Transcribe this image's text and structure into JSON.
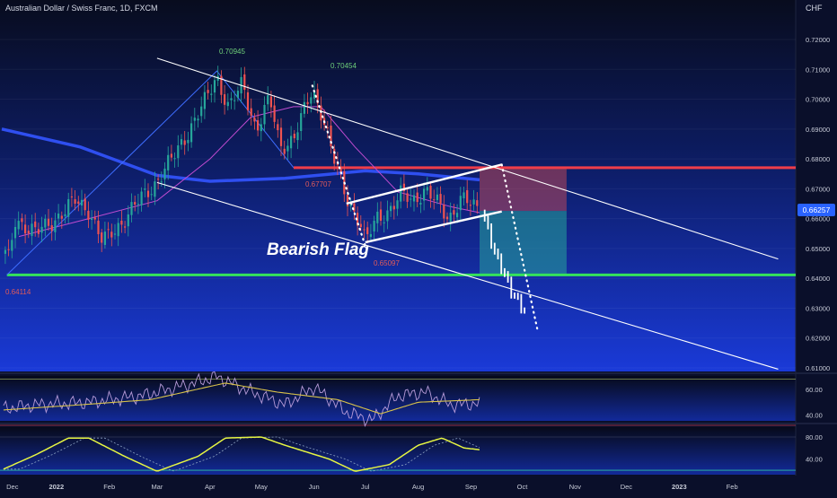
{
  "header": {
    "title": "Australian Dollar / Swiss Franc, 1D, FXCM",
    "currency": "CHF"
  },
  "colors": {
    "bull": "#26a69a",
    "bear": "#ef5350",
    "ma_long": "#2f4ff0",
    "ma_short": "#c04bd0",
    "support": "#35e35b",
    "resistance": "#ef3d4a",
    "price_badge": "#2962ff",
    "rsi": "#b79bd8",
    "rsi_signal": "#d8c24a",
    "osc": "#e6f542"
  },
  "main": {
    "price_label": "0.66257",
    "annotations": {
      "high1": "0.70945",
      "high2": "0.70454",
      "mid": "0.67707",
      "low_flag": "0.65097",
      "low_start": "0.64114",
      "pattern": "Bearish Flag"
    }
  },
  "chart_data": [
    {
      "type": "candlestick",
      "title": "Australian Dollar / Swiss Franc, 1D, FXCM",
      "ylim": [
        0.61,
        0.72
      ],
      "y_ticks": [
        "0.72000",
        "0.71000",
        "0.70000",
        "0.69000",
        "0.68000",
        "0.67000",
        "0.66000",
        "0.65000",
        "0.64000",
        "0.63000",
        "0.62000",
        "0.61000"
      ],
      "x_ticks": [
        "Dec",
        "2022",
        "Feb",
        "Mar",
        "Apr",
        "May",
        "Jun",
        "Jul",
        "Aug",
        "Sep",
        "Oct",
        "Nov",
        "Dec",
        "2023",
        "Feb"
      ],
      "key_points": [
        {
          "date": "2021-12-03",
          "price": 0.64114
        },
        {
          "date": "2022-04-05",
          "price": 0.70945
        },
        {
          "date": "2022-05-31",
          "price": 0.70454
        },
        {
          "date": "2022-05-20",
          "price": 0.67707
        },
        {
          "date": "2022-07-01",
          "price": 0.65097
        },
        {
          "date": "2022-09-06",
          "price": 0.66257
        }
      ],
      "close_path": [
        [
          "2021-12-01",
          0.654
        ],
        [
          "2021-12-03",
          0.643
        ],
        [
          "2021-12-08",
          0.66
        ],
        [
          "2021-12-20",
          0.655
        ],
        [
          "2022-01-05",
          0.662
        ],
        [
          "2022-01-12",
          0.666
        ],
        [
          "2022-01-20",
          0.663
        ],
        [
          "2022-01-28",
          0.652
        ],
        [
          "2022-02-07",
          0.658
        ],
        [
          "2022-02-17",
          0.665
        ],
        [
          "2022-02-28",
          0.672
        ],
        [
          "2022-03-10",
          0.68
        ],
        [
          "2022-03-20",
          0.69
        ],
        [
          "2022-03-30",
          0.7
        ],
        [
          "2022-04-05",
          0.708
        ],
        [
          "2022-04-12",
          0.697
        ],
        [
          "2022-04-20",
          0.705
        ],
        [
          "2022-04-28",
          0.69
        ],
        [
          "2022-05-06",
          0.7
        ],
        [
          "2022-05-12",
          0.684
        ],
        [
          "2022-05-20",
          0.687
        ],
        [
          "2022-05-25",
          0.694
        ],
        [
          "2022-05-31",
          0.703
        ],
        [
          "2022-06-06",
          0.695
        ],
        [
          "2022-06-13",
          0.679
        ],
        [
          "2022-06-20",
          0.667
        ],
        [
          "2022-06-28",
          0.659
        ],
        [
          "2022-07-01",
          0.652
        ],
        [
          "2022-07-08",
          0.66
        ],
        [
          "2022-07-15",
          0.663
        ],
        [
          "2022-07-22",
          0.668
        ],
        [
          "2022-07-29",
          0.666
        ],
        [
          "2022-08-05",
          0.67
        ],
        [
          "2022-08-12",
          0.665
        ],
        [
          "2022-08-19",
          0.66
        ],
        [
          "2022-08-26",
          0.667
        ],
        [
          "2022-09-02",
          0.664
        ],
        [
          "2022-09-06",
          0.66257
        ]
      ],
      "projection_path": [
        [
          "2022-09-09",
          0.66
        ],
        [
          "2022-09-13",
          0.652
        ],
        [
          "2022-09-16",
          0.647
        ],
        [
          "2022-09-21",
          0.641
        ],
        [
          "2022-09-24",
          0.636
        ],
        [
          "2022-09-28",
          0.633
        ],
        [
          "2022-10-01",
          0.63
        ],
        [
          "2022-10-04",
          0.628
        ]
      ],
      "moving_averages": [
        {
          "color_key": "ma_long",
          "values": [
            [
              "2021-11-30",
              0.69
            ],
            [
              "2022-01-15",
              0.684
            ],
            [
              "2022-03-01",
              0.6745
            ],
            [
              "2022-04-01",
              0.6725
            ],
            [
              "2022-05-15",
              0.6735
            ],
            [
              "2022-07-01",
              0.676
            ],
            [
              "2022-08-01",
              0.675
            ],
            [
              "2022-09-06",
              0.673
            ]
          ]
        },
        {
          "color_key": "ma_short",
          "values": [
            [
              "2021-12-10",
              0.654
            ],
            [
              "2022-01-20",
              0.66
            ],
            [
              "2022-03-01",
              0.666
            ],
            [
              "2022-04-01",
              0.68
            ],
            [
              "2022-04-25",
              0.694
            ],
            [
              "2022-05-20",
              0.6975
            ],
            [
              "2022-06-05",
              0.6975
            ],
            [
              "2022-06-25",
              0.684
            ],
            [
              "2022-07-20",
              0.669
            ],
            [
              "2022-08-20",
              0.664
            ],
            [
              "2022-09-06",
              0.662
            ]
          ]
        }
      ],
      "horizontal_levels": [
        {
          "color_key": "support",
          "price": 0.64114,
          "from": "2021-12-03"
        },
        {
          "color_key": "resistance",
          "price": 0.67707,
          "from": "2022-05-20"
        }
      ],
      "trendlines": [
        [
          [
            "2022-03-01",
            0.71372
          ],
          [
            "2023-02-28",
            0.64648
          ]
        ],
        [
          [
            "2022-03-01",
            0.6721
          ],
          [
            "2023-02-28",
            0.60957
          ]
        ],
        [
          [
            "2022-06-20",
            0.66504
          ],
          [
            "2022-09-19",
            0.67811
          ]
        ],
        [
          [
            "2022-07-01",
            0.65207
          ],
          [
            "2022-09-19",
            0.66238
          ]
        ]
      ],
      "dotted_paths": [
        [
          [
            "2022-05-31",
            0.70454
          ],
          [
            "2022-07-01",
            0.65097
          ]
        ],
        [
          [
            "2022-09-19",
            0.67811
          ],
          [
            "2022-10-10",
            0.62255
          ]
        ]
      ],
      "wedge": [
        [
          "2021-12-03",
          0.64114
        ],
        [
          "2022-04-05",
          0.70945
        ],
        [
          "2022-05-20",
          0.67707
        ]
      ],
      "trade_box": {
        "from": "2022-09-06",
        "to": "2022-10-27",
        "stop": 0.67707,
        "entry": 0.66257,
        "target": 0.64114
      }
    },
    {
      "type": "line",
      "title": "",
      "ylim": [
        32,
        74
      ],
      "y_ticks": [
        "60.00",
        "40.00"
      ],
      "series": [
        {
          "color_key": "rsi",
          "values": [
            [
              "2021-12-01",
              45
            ],
            [
              "2021-12-20",
              48
            ],
            [
              "2022-01-20",
              50
            ],
            [
              "2022-02-20",
              55
            ],
            [
              "2022-03-20",
              64
            ],
            [
              "2022-04-05",
              70
            ],
            [
              "2022-04-25",
              58
            ],
            [
              "2022-05-15",
              48
            ],
            [
              "2022-06-01",
              62
            ],
            [
              "2022-06-20",
              42
            ],
            [
              "2022-07-05",
              36
            ],
            [
              "2022-07-20",
              55
            ],
            [
              "2022-08-05",
              58
            ],
            [
              "2022-08-20",
              48
            ],
            [
              "2022-09-06",
              49
            ]
          ]
        },
        {
          "color_key": "rsi_signal",
          "values": [
            [
              "2021-12-01",
              44
            ],
            [
              "2022-01-15",
              48
            ],
            [
              "2022-02-25",
              52
            ],
            [
              "2022-04-10",
              65
            ],
            [
              "2022-05-10",
              58
            ],
            [
              "2022-06-15",
              52
            ],
            [
              "2022-07-10",
              41
            ],
            [
              "2022-08-01",
              50
            ],
            [
              "2022-09-06",
              52
            ]
          ]
        }
      ]
    },
    {
      "type": "line",
      "title": "",
      "ylim": [
        12,
        88
      ],
      "y_ticks": [
        "80.00",
        "40.00"
      ],
      "series": [
        {
          "color_key": "osc",
          "values": [
            [
              "2021-12-01",
              22
            ],
            [
              "2021-12-20",
              48
            ],
            [
              "2022-01-08",
              78
            ],
            [
              "2022-01-20",
              78
            ],
            [
              "2022-02-10",
              45
            ],
            [
              "2022-03-01",
              18
            ],
            [
              "2022-03-25",
              45
            ],
            [
              "2022-04-10",
              78
            ],
            [
              "2022-05-01",
              80
            ],
            [
              "2022-05-15",
              65
            ],
            [
              "2022-06-10",
              40
            ],
            [
              "2022-06-25",
              18
            ],
            [
              "2022-07-15",
              30
            ],
            [
              "2022-08-01",
              65
            ],
            [
              "2022-08-15",
              78
            ],
            [
              "2022-08-28",
              60
            ],
            [
              "2022-09-06",
              57
            ]
          ]
        }
      ]
    }
  ]
}
